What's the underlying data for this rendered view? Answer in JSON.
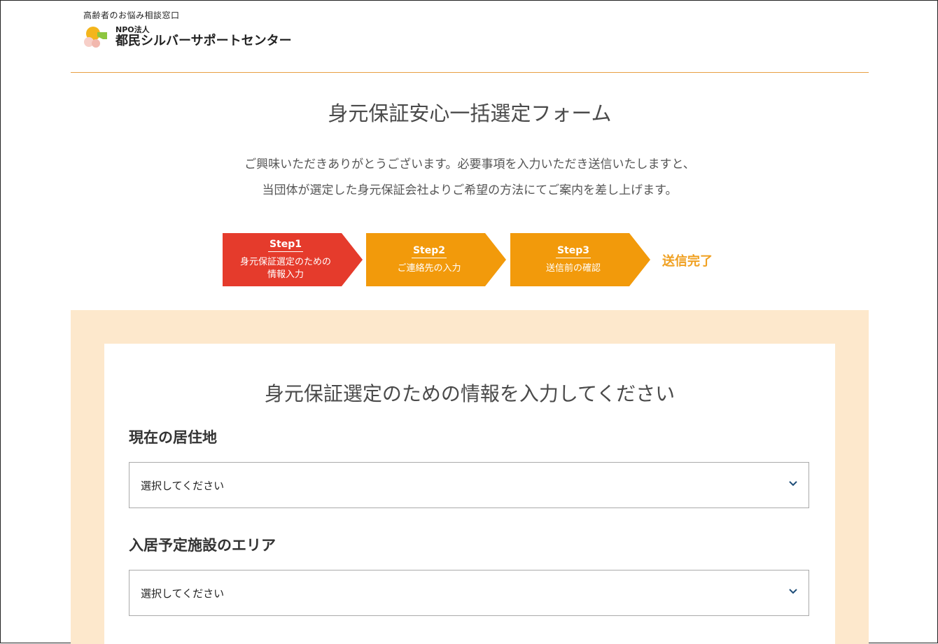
{
  "header": {
    "tagline": "高齢者のお悩み相談窓口",
    "npo": "NPO法人",
    "org_name": "都民シルバーサポートセンター"
  },
  "page": {
    "title": "身元保証安心一括選定フォーム",
    "intro_line1": "ご興味いただきありがとうございます。必要事項を入力いただき送信いたしますと、",
    "intro_line2": "当団体が選定した身元保証会社よりご希望の方法にてご案内を差し上げます。"
  },
  "steps": [
    {
      "title": "Step1",
      "desc_line1": "身元保証選定のための",
      "desc_line2": "情報入力",
      "color": "#e53b2c",
      "active": true
    },
    {
      "title": "Step2",
      "desc_line1": "ご連絡先の入力",
      "desc_line2": "",
      "color": "#f29a0b",
      "active": false
    },
    {
      "title": "Step3",
      "desc_line1": "送信前の確認",
      "desc_line2": "",
      "color": "#f29a0b",
      "active": false
    }
  ],
  "step_done": "送信完了",
  "form": {
    "heading": "身元保証選定のための情報を入力してください",
    "fields": [
      {
        "label": "現在の居住地",
        "value": "選択してください"
      },
      {
        "label": "入居予定施設のエリア",
        "value": "選択してください"
      }
    ]
  },
  "colors": {
    "accent_orange": "#f29a0b",
    "active_red": "#e53b2c",
    "form_bg": "#fde8cc",
    "rule": "#e8a043",
    "chevron": "#1f4e79"
  },
  "icons": {
    "logo": "org-logo-icon",
    "select_chevron": "chevron-down-icon"
  }
}
